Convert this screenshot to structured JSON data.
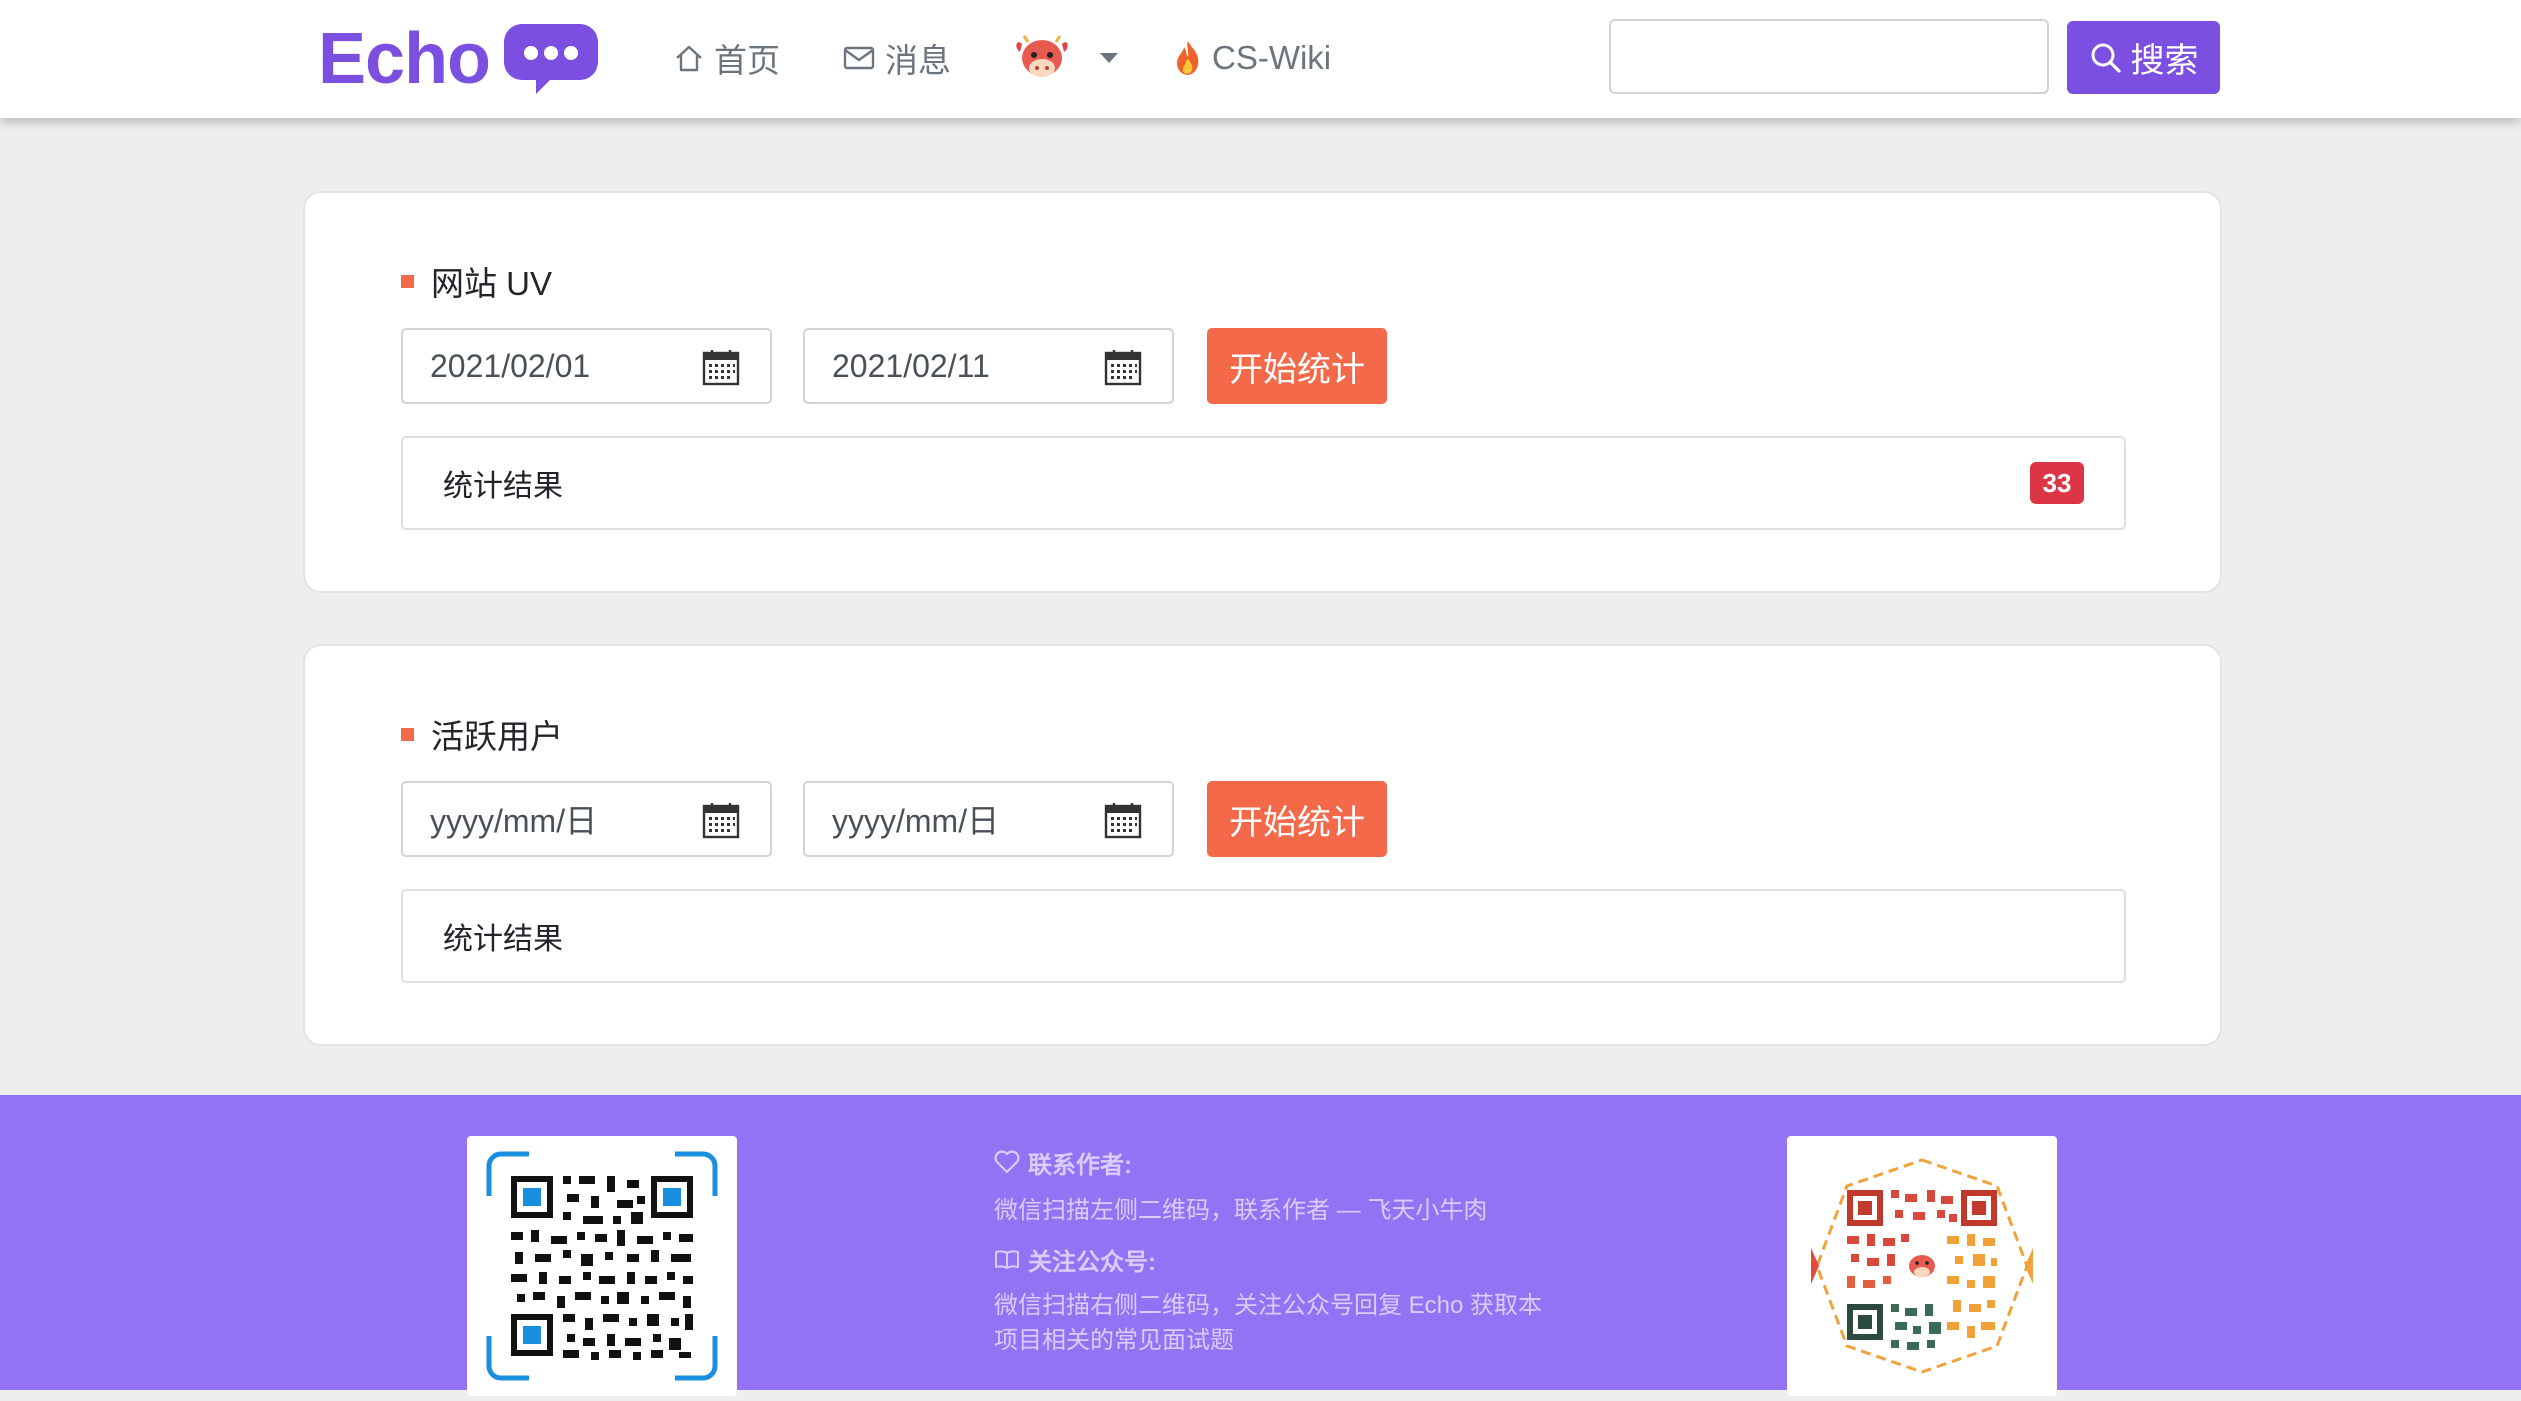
{
  "navbar": {
    "logo": "Echo",
    "home_label": "首页",
    "messages_label": "消息",
    "wiki_label": "CS-Wiki",
    "search_value": "",
    "search_placeholder": "",
    "search_button_label": "搜索",
    "brand_color": "#7b4fe0"
  },
  "uv_card": {
    "title": "网站 UV",
    "start_date": "2021/02/01",
    "end_date": "2021/02/11",
    "submit_label": "开始统计",
    "result_label": "统计结果",
    "result_count": "33"
  },
  "active_card": {
    "title": "活跃用户",
    "start_placeholder": "yyyy/mm/日",
    "end_placeholder": "yyyy/mm/日",
    "submit_label": "开始统计",
    "result_label": "统计结果"
  },
  "footer": {
    "contact_heading": "联系作者:",
    "contact_text": "微信扫描左侧二维码，联系作者 — 飞天小牛肉",
    "follow_heading": "关注公众号:",
    "follow_text_line1": "微信扫描右侧二维码，关注公众号回复 Echo 获取本",
    "follow_text_line2": "项目相关的常见面试题",
    "footer_color": "#9373f3"
  },
  "icons": [
    "home-icon",
    "envelope-icon",
    "cow-avatar-icon",
    "caret-down-icon",
    "fire-icon",
    "search-icon",
    "calendar-icon",
    "heart-icon",
    "book-icon",
    "qr-code-icon"
  ],
  "accent_color": "#f4694a",
  "badge_color": "#dc3545"
}
